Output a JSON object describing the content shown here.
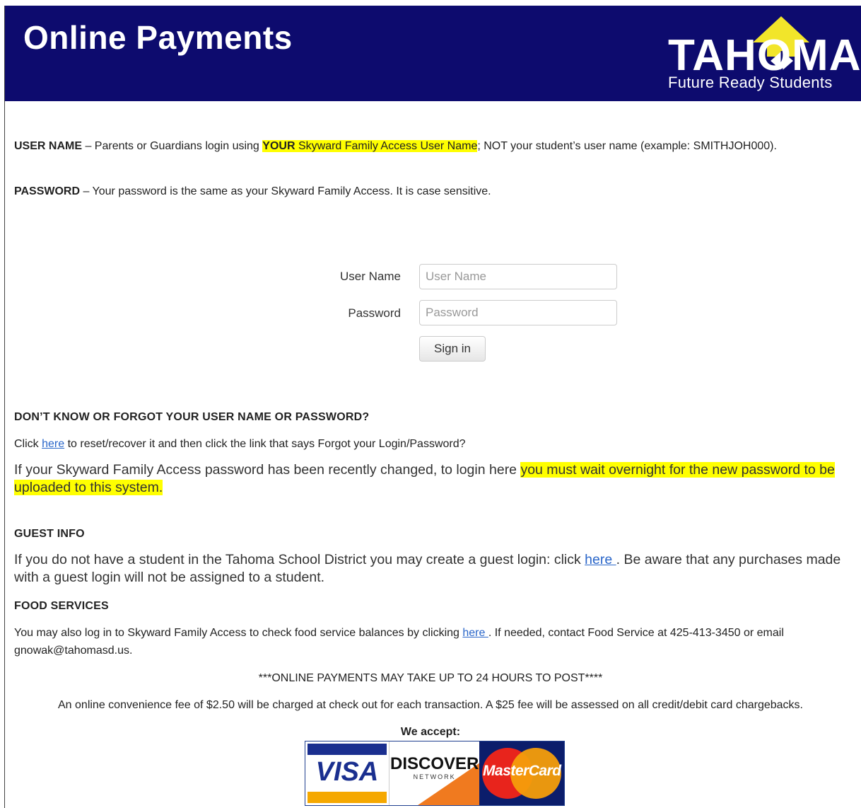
{
  "header": {
    "title": "Online Payments",
    "logo_text": "TAHOMA",
    "logo_tagline": "Future Ready Students",
    "bg_color": "#0d0b6e"
  },
  "intro": {
    "username_label": "USER NAME",
    "username_text_1": " – Parents or Guardians login using ",
    "username_your": "YOUR",
    "username_highlight": " Skyward Family Access User Name",
    "username_text_2": "; NOT your student’s user name (example: SMITHJOH000).",
    "password_label": "PASSWORD",
    "password_text": " – Your password is the same as your Skyward Family Access. It is case sensitive."
  },
  "login_form": {
    "username_label": "User Name",
    "username_placeholder": "User Name",
    "password_label": "Password",
    "password_placeholder": "Password",
    "signin_label": "Sign in"
  },
  "forgot": {
    "heading": "DON’T KNOW OR FORGOT YOUR USER NAME OR PASSWORD?",
    "text_1": "Click ",
    "link": "here",
    "text_2": "  to reset/recover it and then click the link that says Forgot your Login/Password?",
    "notice_1": "If your Skyward Family Access password has been recently changed, to login here ",
    "notice_highlight": "you must wait overnight for the new password to be uploaded to this system."
  },
  "guest": {
    "heading": "GUEST INFO",
    "text_1": "If you do not have a student in the Tahoma School District you may create a guest login: click ",
    "link": "here ",
    "text_2": ". Be aware that any purchases made with a guest login will not be assigned to a student."
  },
  "food": {
    "heading": "FOOD SERVICES",
    "text_1": "You may also log in to Skyward Family Access to check food service balances by clicking ",
    "link": "here ",
    "text_2": ".  If needed, contact Food Service at 425-413-3450 or email gnowak@tahomasd.us."
  },
  "footer": {
    "notice": "***ONLINE PAYMENTS MAY TAKE UP TO 24 HOURS TO POST****",
    "fee": "An online convenience fee of $2.50 will be charged at check out for each transaction. A $25 fee will be assessed on all credit/debit card chargebacks.",
    "accept_label": "We accept:",
    "cards": [
      "VISA",
      "DISCOVER",
      "NETWORK",
      "MasterCard"
    ]
  }
}
